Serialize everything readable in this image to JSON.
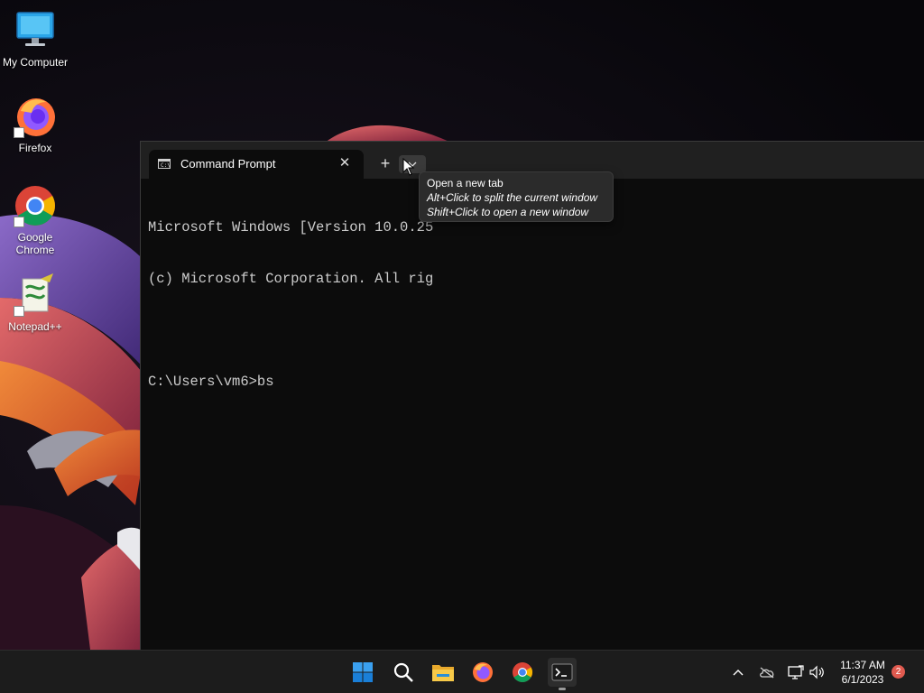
{
  "desktop": {
    "icons": [
      {
        "label": "My Computer",
        "icon": "monitor-icon"
      },
      {
        "label": "Firefox",
        "icon": "firefox-icon"
      },
      {
        "label": "Google Chrome",
        "icon": "chrome-icon"
      },
      {
        "label": "Notepad++",
        "icon": "notepadpp-icon"
      }
    ]
  },
  "terminal": {
    "tab_title": "Command Prompt",
    "tab_icon": "cmd-icon",
    "close_glyph": "✕",
    "new_tab_glyph": "+",
    "console_lines": [
      "Microsoft Windows [Version 10.0.25",
      "(c) Microsoft Corporation. All rig",
      "",
      "C:\\Users\\vm6>bs"
    ]
  },
  "tooltip": {
    "title": "Open a new tab",
    "line1": "Alt+Click to split the current window",
    "line2": "Shift+Click to open a new window"
  },
  "taskbar": {
    "apps": [
      "start-icon",
      "search-icon",
      "file-explorer-icon",
      "firefox-icon",
      "chrome-icon",
      "terminal-icon"
    ],
    "tray": [
      "chevron-up-icon",
      "onedrive-icon",
      "network-icon",
      "volume-icon"
    ],
    "time": "11:37 AM",
    "date": "6/1/2023",
    "notification_count": "2"
  },
  "colors": {
    "accent_blue": "#0078d4",
    "terminal_bg": "#0c0c0c",
    "taskbar_bg": "#1c1c1c",
    "badge": "#e05a4f"
  }
}
